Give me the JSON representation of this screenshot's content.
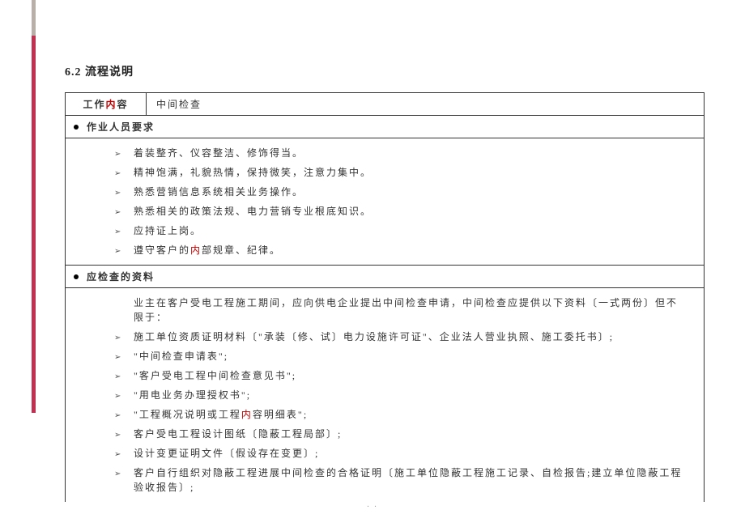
{
  "heading": "6.2 流程说明",
  "header_row": {
    "label_prefix": "工作",
    "label_red": "内",
    "label_suffix": "容",
    "value": "中间检查"
  },
  "section1": {
    "title": "作业人员要求",
    "items": [
      {
        "text": "着装整齐、仪容整洁、修饰得当。"
      },
      {
        "text": "精神饱满，礼貌热情，保持微笑，注意力集中。"
      },
      {
        "text": "熟悉营销信息系统相关业务操作。"
      },
      {
        "text": "熟悉相关的政策法规、电力营销专业根底知识。"
      },
      {
        "text": "应持证上岗。"
      },
      {
        "pre": "遵守客户的",
        "red": "内",
        "post": "部规章、纪律。"
      }
    ]
  },
  "section2": {
    "title": "应检查的资料",
    "intro": "业主在客户受电工程施工期间，应向供电企业提出中间检查申请，中间检查应提供以下资料〔一式两份〕但不限于：",
    "items": [
      {
        "text": "施工单位资质证明材料〔\"承装〔修、试〕电力设施许可证\"、企业法人营业执照、施工委托书〕;"
      },
      {
        "text": "\"中间检查申请表\";"
      },
      {
        "text": "\"客户受电工程中间检查意见书\";"
      },
      {
        "text": "\"用电业务办理授权书\";"
      },
      {
        "pre": "\"工程概况说明或工程",
        "red": "内",
        "post": "容明细表\";"
      },
      {
        "text": "客户受电工程设计图纸〔隐蔽工程局部〕;"
      },
      {
        "text": "设计变更证明文件〔假设存在变更〕;"
      },
      {
        "text": "客户自行组织对隐蔽工程进展中间检查的合格证明〔施工单位隐蔽工程施工记录、自检报告;建立单位隐蔽工程验收报告〕;"
      }
    ]
  },
  "page_number": ". ."
}
